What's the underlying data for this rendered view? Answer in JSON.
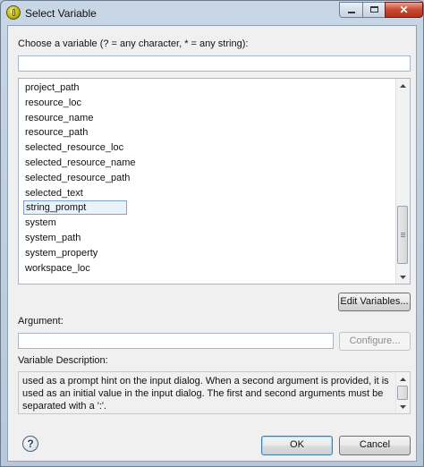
{
  "window": {
    "title": "Select Variable",
    "close_glyph": "✕"
  },
  "filter": {
    "label": "Choose a variable (? = any character, * = any string):",
    "value": ""
  },
  "variables": {
    "items": [
      "project_path",
      "resource_loc",
      "resource_name",
      "resource_path",
      "selected_resource_loc",
      "selected_resource_name",
      "selected_resource_path",
      "selected_text",
      "string_prompt",
      "system",
      "system_path",
      "system_property",
      "workspace_loc"
    ],
    "selected": "string_prompt"
  },
  "buttons": {
    "edit_variables": "Edit Variables...",
    "configure": "Configure...",
    "ok": "OK",
    "cancel": "Cancel"
  },
  "argument": {
    "label": "Argument:",
    "value": ""
  },
  "description": {
    "label": "Variable Description:",
    "text": "used as a prompt hint on the input dialog. When a second argument is provided, it is used as an initial value in the input dialog. The first and second arguments must be separated with a ':'."
  },
  "help": {
    "glyph": "?"
  },
  "colors": {
    "selection_border": "#7da2ce",
    "default_button_border": "#3c7fb1",
    "close_button": "#c8472f"
  }
}
